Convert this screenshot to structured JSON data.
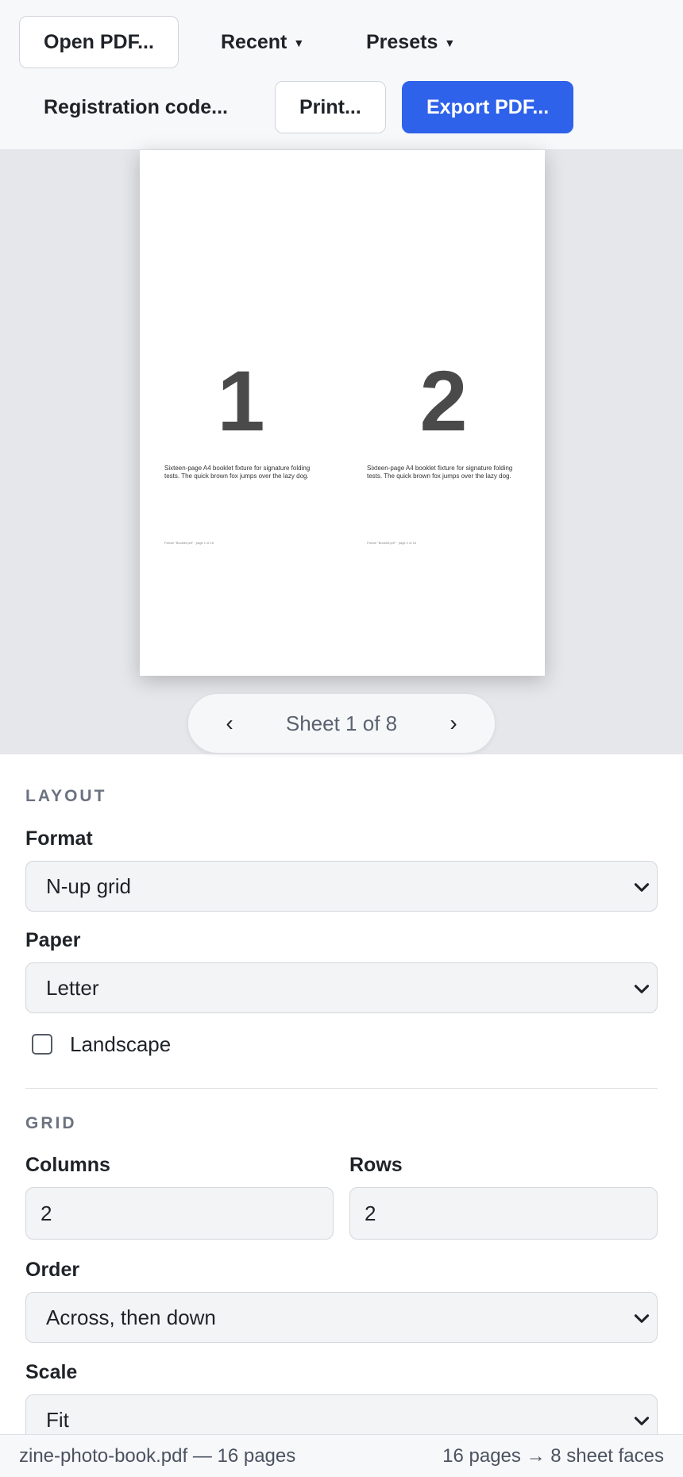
{
  "toolbar": {
    "open_label": "Open PDF...",
    "recent_label": "Recent",
    "presets_label": "Presets",
    "dropdown_caret": "▼",
    "registration_label": "Registration code...",
    "print_label": "Print...",
    "export_label": "Export PDF...",
    "accent_color": "#2f62ea"
  },
  "preview": {
    "pages": [
      {
        "number": "1",
        "text": "Sixteen-page A4 booklet fixture for signature folding tests. The quick brown fox jumps over the lazy dog.",
        "footer": "Fixture \"Booklet.pdf\" · page 1 of 16"
      },
      {
        "number": "2",
        "text": "Sixteen-page A4 booklet fixture for signature folding tests. The quick brown fox jumps over the lazy dog.",
        "footer": "Fixture \"Booklet.pdf\" · page 2 of 16"
      }
    ],
    "pager": {
      "prev": "‹",
      "label": "Sheet 1 of 8",
      "next": "›"
    }
  },
  "layout": {
    "heading": "LAYOUT",
    "format_label": "Format",
    "format_value": "N-up grid",
    "paper_label": "Paper",
    "paper_value": "Letter",
    "landscape_label": "Landscape",
    "landscape_checked": false
  },
  "grid": {
    "heading": "GRID",
    "columns_label": "Columns",
    "columns_value": "2",
    "rows_label": "Rows",
    "rows_value": "2",
    "order_label": "Order",
    "order_value": "Across, then down",
    "scale_label": "Scale",
    "scale_value": "Fit"
  },
  "status": {
    "file_info": "zine-photo-book.pdf — 16 pages",
    "sheet_info": "16 pages → 8 sheet faces"
  }
}
